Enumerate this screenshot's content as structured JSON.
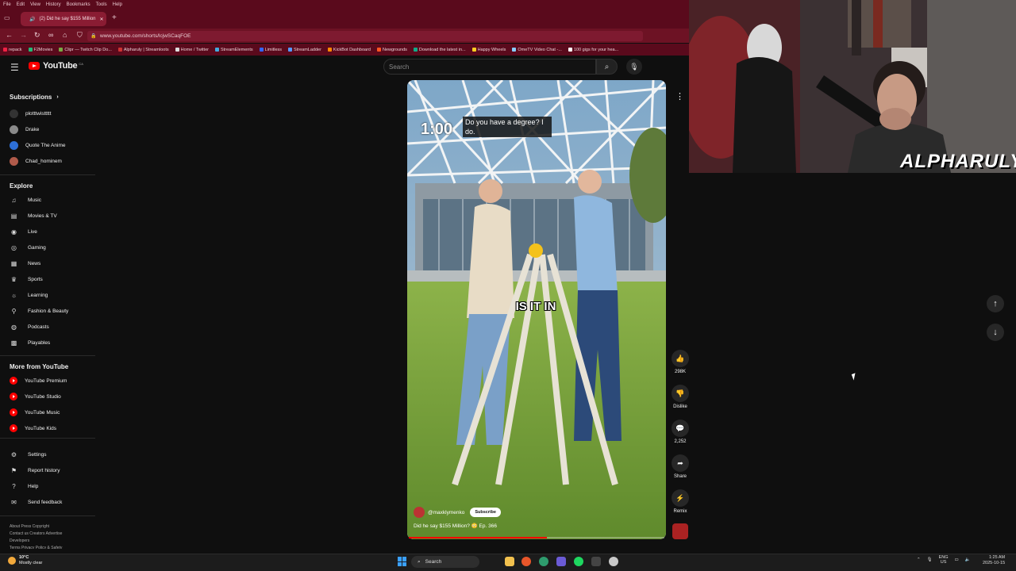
{
  "browser": {
    "menu": [
      "File",
      "Edit",
      "View",
      "History",
      "Bookmarks",
      "Tools",
      "Help"
    ],
    "tab_title": "(2) Did he say $155 Million",
    "url": "www.youtube.com/shorts/lcjwSCaqFOE",
    "bookmarks": [
      "repack",
      "F2Movies",
      "Clipr — Twitch Clip Do...",
      "Alpharuly | Streamloots",
      "Home / Twitter",
      "StreamElements",
      "Limitless",
      "StreamLadder",
      "KickBot Dashboard",
      "Newgrounds",
      "Download the latest in...",
      "Happy Wheels",
      "OmeTV Video Chat -...",
      "100 gigs for your hea..."
    ]
  },
  "youtube": {
    "logo_text": "YouTube",
    "logo_country": "CA",
    "search_placeholder": "Search"
  },
  "sidebar": {
    "subscriptions_heading": "Subscriptions",
    "subscriptions": [
      {
        "label": "plotttwisttttt",
        "color": "#333333"
      },
      {
        "label": "Drake",
        "color": "#8a8a8a"
      },
      {
        "label": "Quote The Anime",
        "color": "#2d6fd6"
      },
      {
        "label": "Chad_hominem",
        "color": "#b05a4a"
      }
    ],
    "explore_heading": "Explore",
    "explore": [
      {
        "label": "Music",
        "icon": "music-note-icon"
      },
      {
        "label": "Movies & TV",
        "icon": "film-icon"
      },
      {
        "label": "Live",
        "icon": "live-icon"
      },
      {
        "label": "Gaming",
        "icon": "gamepad-icon"
      },
      {
        "label": "News",
        "icon": "newspaper-icon"
      },
      {
        "label": "Sports",
        "icon": "trophy-icon"
      },
      {
        "label": "Learning",
        "icon": "bulb-icon"
      },
      {
        "label": "Fashion & Beauty",
        "icon": "hanger-icon"
      },
      {
        "label": "Podcasts",
        "icon": "podcast-icon"
      },
      {
        "label": "Playables",
        "icon": "grid-icon"
      }
    ],
    "more_heading": "More from YouTube",
    "more": [
      "YouTube Premium",
      "YouTube Studio",
      "YouTube Music",
      "YouTube Kids"
    ],
    "settings": [
      {
        "label": "Settings",
        "icon": "gear-icon"
      },
      {
        "label": "Report history",
        "icon": "flag-icon"
      },
      {
        "label": "Help",
        "icon": "help-icon"
      },
      {
        "label": "Send feedback",
        "icon": "feedback-icon"
      }
    ],
    "footer_line1": "About  Press  Copyright",
    "footer_line2": "Contact us  Creators  Advertise",
    "footer_line3": "Developers",
    "footer_line4": "Terms  Privacy  Policy & Safety"
  },
  "short": {
    "caption_top": "Do you have a degree? I do.",
    "timer": "1:00",
    "subtitle": "IS IT IN",
    "channel": "@maxklymenko",
    "subscribe": "Subscribe",
    "title": "Did he say $155 Million? 😳 Ep. 366",
    "progress_fraction": 0.54,
    "likes": "298K",
    "dislike": "Dislike",
    "comments": "2,252",
    "share": "Share",
    "remix": "Remix"
  },
  "stream": {
    "streamer_name": "ALPHARULY"
  },
  "taskbar": {
    "temp": "10°C",
    "weather": "Mostly clear",
    "search": "Search",
    "lang1": "ENG",
    "lang2": "US",
    "time": "1:25 AM",
    "date": "2025-10-15"
  }
}
